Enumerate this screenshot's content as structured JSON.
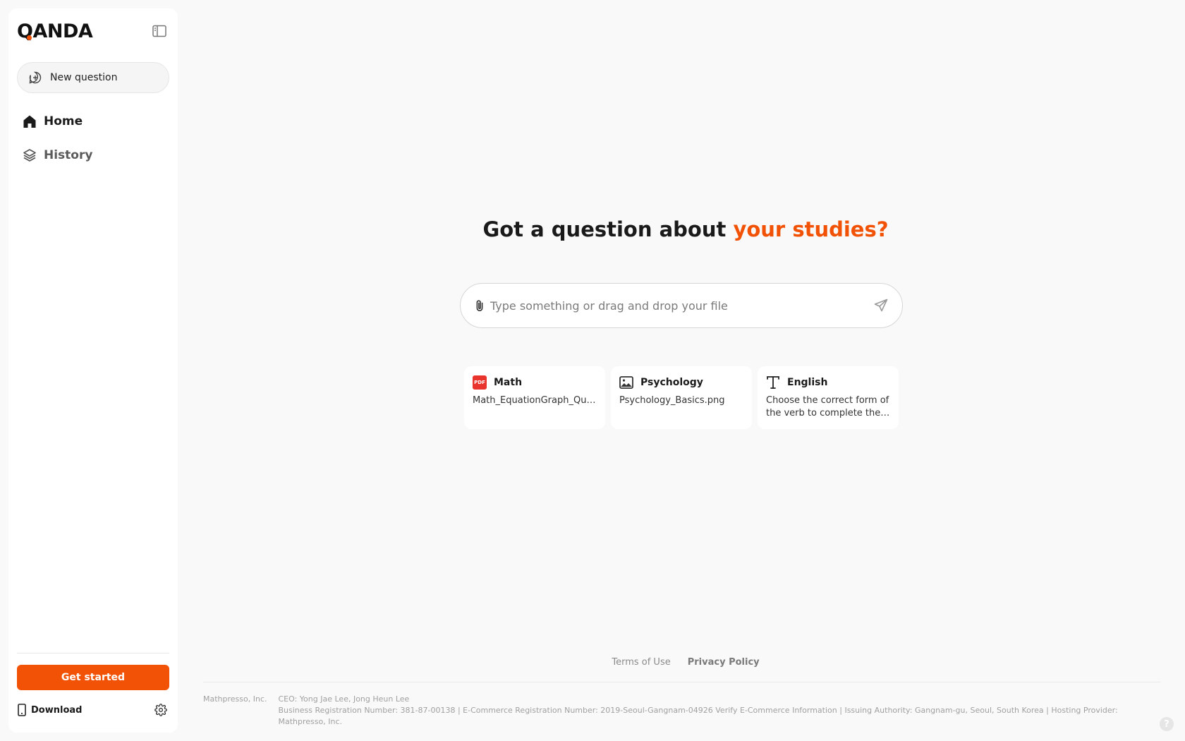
{
  "brand": {
    "logo_text_rest": "ANDA",
    "logo_q": "Q",
    "accent_color": "#f25206"
  },
  "sidebar": {
    "new_question": "New question",
    "nav": [
      {
        "label": "Home",
        "icon": "home-icon",
        "active": true
      },
      {
        "label": "History",
        "icon": "layers-icon",
        "active": false
      }
    ],
    "get_started": "Get started",
    "download": "Download"
  },
  "main": {
    "headline_prefix": "Got a question about ",
    "headline_accent": "your studies?",
    "search_placeholder": "Type something or drag and drop your file",
    "cards": [
      {
        "title": "Math",
        "icon": "pdf-icon",
        "icon_text": "PDF",
        "body": "Math_EquationGraph_Question.pdf"
      },
      {
        "title": "Psychology",
        "icon": "image-icon",
        "body": "Psychology_Basics.png"
      },
      {
        "title": "English",
        "icon": "text-icon",
        "body": "Choose the correct form of the verb to complete the sentence."
      }
    ]
  },
  "footer": {
    "terms": "Terms of Use",
    "privacy": "Privacy Policy",
    "company": "Mathpresso, Inc.",
    "ceo": "CEO: Yong Jae Lee, Jong Heun Lee",
    "registration": "Business Registration Number: 381-87-00138 | E-Commerce Registration Number: 2019-Seoul-Gangnam-04926 Verify E-Commerce Information | Issuing Authority: Gangnam-gu, Seoul, South Korea | Hosting Provider: Mathpresso, Inc.",
    "help": "?"
  }
}
